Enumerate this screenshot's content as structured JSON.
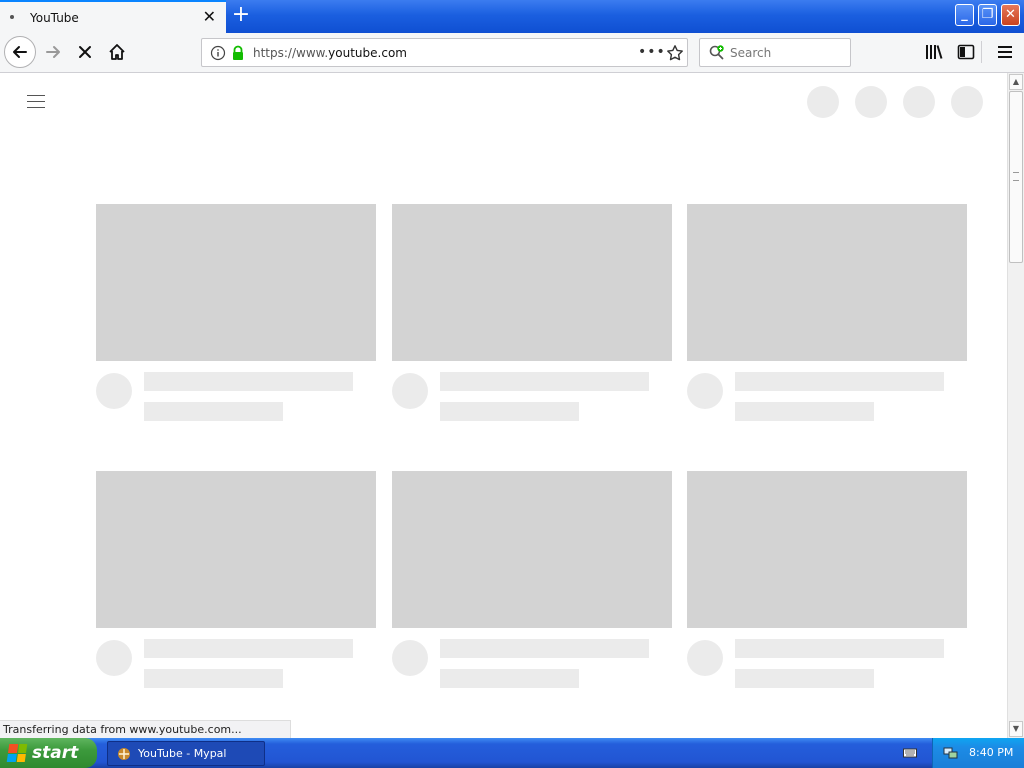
{
  "browser": {
    "tab": {
      "title": "YouTube",
      "close_glyph": "✕"
    },
    "new_tab_glyph": "+",
    "window_buttons": {
      "minimize": "_",
      "maximize": "❐",
      "close": "✕"
    },
    "url": "https://www.youtube.com",
    "url_prefix": "https://www.",
    "url_domain": "youtube.com",
    "url_menu": "•••",
    "search_placeholder": "Search",
    "status_text": "Transferring data from www.youtube.com..."
  },
  "taskbar": {
    "start_label": "start",
    "window_item": "YouTube - Mypal",
    "clock": "8:40 PM"
  },
  "icons": {
    "back": "back-arrow-icon",
    "forward": "forward-arrow-icon",
    "stop": "stop-icon",
    "home": "home-icon",
    "info": "info-icon",
    "lock": "lock-icon",
    "star": "bookmark-star-icon",
    "search": "search-icon",
    "library": "library-icon",
    "sidebar": "sidebar-icon",
    "menu": "hamburger-menu-icon"
  },
  "colors": {
    "placeholder_dark": "#d3d3d3",
    "placeholder_light": "#ebebeb",
    "lock_green": "#12bc00",
    "xp_blue": "#245edb",
    "xp_start_green": "#3c9a3c"
  }
}
